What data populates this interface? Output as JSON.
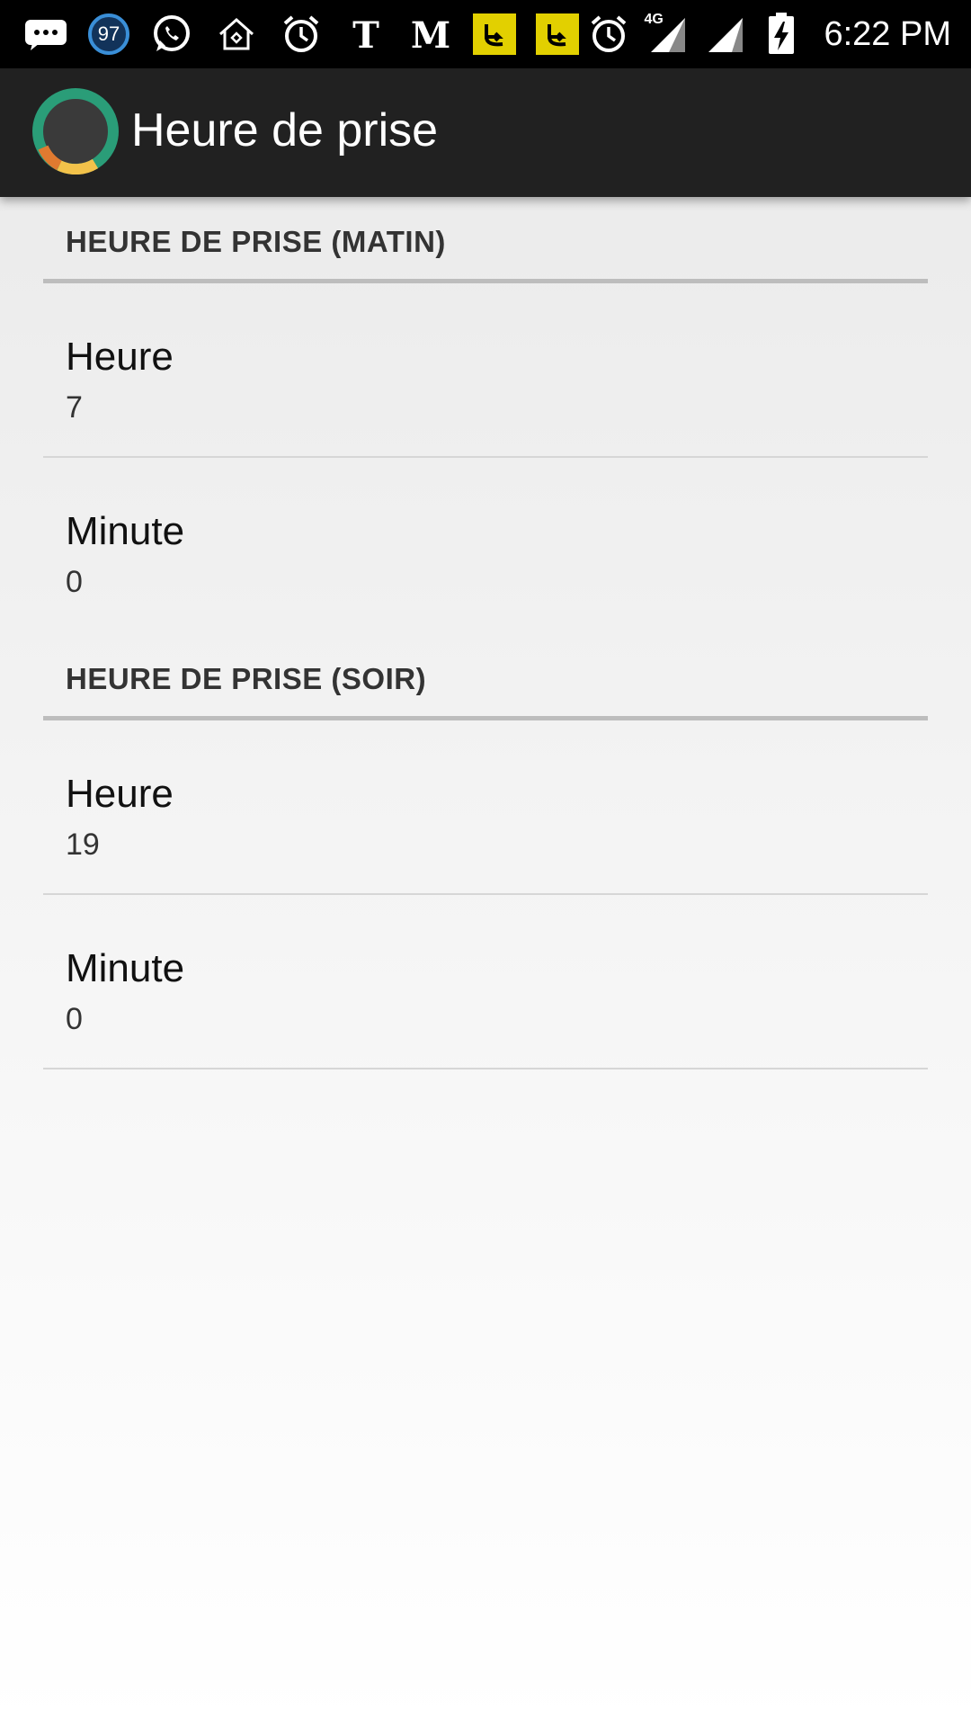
{
  "status_bar": {
    "time": "6:22 PM",
    "badge_count": "97",
    "network_label": "4G",
    "icons": [
      "message-icon",
      "badge-97-icon",
      "whatsapp-icon",
      "home-icon",
      "alarm-icon",
      "nyt-icon",
      "lemonde-icon",
      "yellow-app-icon",
      "yellow-app-icon",
      "alarm-icon",
      "signal-4g-icon",
      "signal-icon",
      "battery-charging-icon"
    ]
  },
  "app_bar": {
    "title": "Heure de prise",
    "logo_colors": [
      "#2a9d78",
      "#e07a30",
      "#f2c24a",
      "#3a3a3a"
    ]
  },
  "sections": [
    {
      "header": "HEURE DE PRISE (MATIN)",
      "items": [
        {
          "title": "Heure",
          "value": "7"
        },
        {
          "title": "Minute",
          "value": "0"
        }
      ]
    },
    {
      "header": "HEURE DE PRISE (SOIR)",
      "items": [
        {
          "title": "Heure",
          "value": "19"
        },
        {
          "title": "Minute",
          "value": "0"
        }
      ]
    }
  ],
  "colors": {
    "status_bar": "#000000",
    "app_bar": "#212121",
    "section_divider": "#bdbdbd",
    "item_divider": "#d6d6d6"
  }
}
